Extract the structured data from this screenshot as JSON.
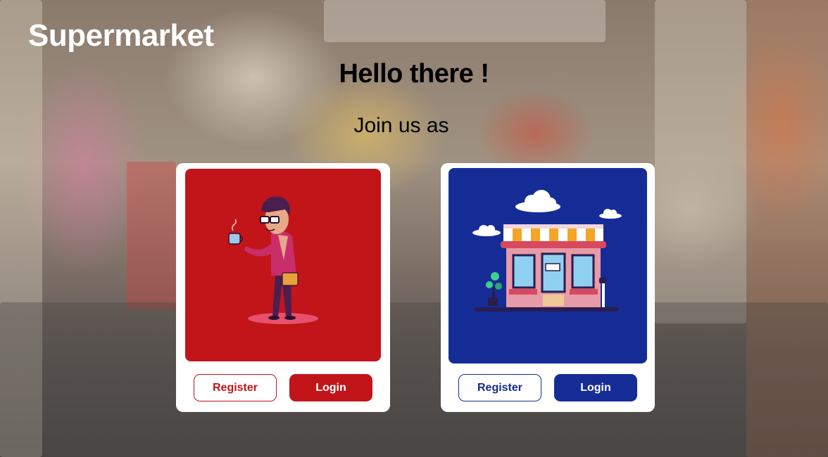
{
  "app": {
    "title": "Supermarket"
  },
  "hero": {
    "greeting": "Hello there !",
    "subtitle": "Join us as"
  },
  "cards": [
    {
      "role": "customer",
      "illustration": "person-with-coffee-icon",
      "accent": "#c1151a",
      "register_label": "Register",
      "login_label": "Login"
    },
    {
      "role": "seller",
      "illustration": "storefront-icon",
      "accent": "#152c97",
      "register_label": "Register",
      "login_label": "Login"
    }
  ]
}
